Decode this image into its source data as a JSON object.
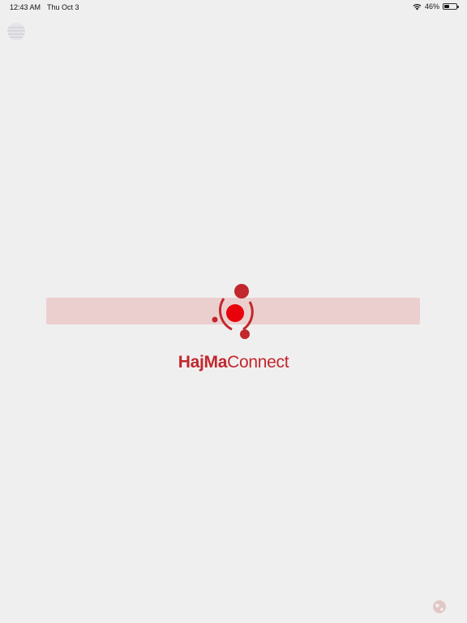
{
  "status_bar": {
    "time": "12:43 AM",
    "date": "Thu Oct 3",
    "battery_percent": "46%",
    "battery_level": 0.46,
    "wifi_icon": "wifi-icon"
  },
  "splash": {
    "brand_bold": "HajMa",
    "brand_regular": "Connect",
    "loading_label": "",
    "accent_color": "#c1272d",
    "loading_bar_color": "#ebcfcf",
    "mark_icon": "hajma-logo-mark",
    "corner_icon": "faded-logo-icon",
    "footer_icon": "globe-icon"
  }
}
